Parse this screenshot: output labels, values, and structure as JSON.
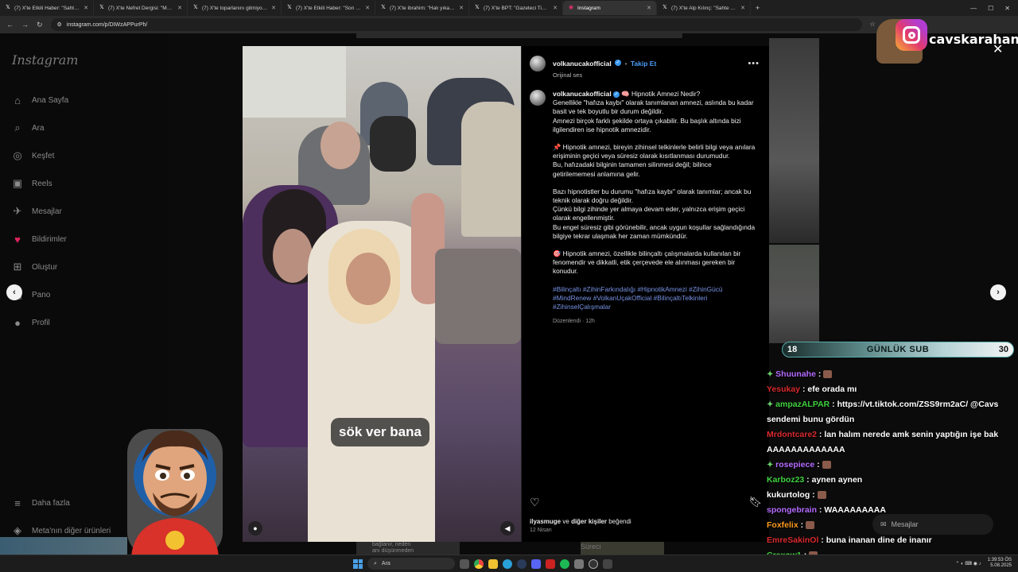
{
  "browser": {
    "tabs": [
      {
        "icon": "x-logo",
        "title": "(7) X'te Etkili Haber: \"Sahte diploma"
      },
      {
        "icon": "x-logo",
        "title": "(7) X'te Nefret Dergisi: \"Mersin'de"
      },
      {
        "icon": "x-logo",
        "title": "(7) X'te toparlanını gitmiyoruz"
      },
      {
        "icon": "x-logo",
        "title": "(7) X'te Etkili Haber: \"Son günlerde"
      },
      {
        "icon": "x-logo",
        "title": "(7) X'te ibrahim: \"Halı yıkamacı"
      },
      {
        "icon": "x-logo",
        "title": "(7) X'te BPT: \"Gazeteci Timur Soy"
      },
      {
        "icon": "instagram-logo",
        "title": "Instagram",
        "active": true
      },
      {
        "icon": "x-logo",
        "title": "(7) X'te Alp Kılınç: \"Sahte diploma"
      }
    ],
    "url": "instagram.com/p/DIWzAPPurPh/"
  },
  "sidebar": {
    "logo": "Instagram",
    "items": [
      {
        "icon": "home-icon",
        "glyph": "⌂",
        "label": "Ana Sayfa"
      },
      {
        "icon": "search-icon",
        "glyph": "⌕",
        "label": "Ara"
      },
      {
        "icon": "explore-icon",
        "glyph": "◎",
        "label": "Keşfet"
      },
      {
        "icon": "reels-icon",
        "glyph": "▣",
        "label": "Reels"
      },
      {
        "icon": "messages-icon",
        "glyph": "✈",
        "label": "Mesajlar"
      },
      {
        "icon": "heart-icon",
        "glyph": "♥",
        "label": "Bildirimler"
      },
      {
        "icon": "create-icon",
        "glyph": "⊞",
        "label": "Oluştur"
      },
      {
        "icon": "dashboard-icon",
        "glyph": "▤",
        "label": "Pano"
      },
      {
        "icon": "profile-icon",
        "glyph": "●",
        "label": "Profil"
      }
    ],
    "bottom": [
      {
        "icon": "menu-icon",
        "glyph": "≡",
        "label": "Daha fazla"
      },
      {
        "icon": "meta-icon",
        "glyph": "◈",
        "label": "Meta'nın diğer ürünleri"
      }
    ]
  },
  "post": {
    "username": "volkanucakofficial",
    "follow_label": "Takip Et",
    "audio": "Orijinal ses",
    "video_caption": "sök ver bana",
    "caption_title": "🧠 Hipnotik Amnezi Nedir?",
    "paragraphs": [
      "Genellikle \"hafıza kaybı\" olarak tanımlanan amnezi, aslında bu kadar basit ve tek boyutlu bir durum değildir.\nAmnezi birçok farklı şekilde ortaya çıkabilir. Bu başlık altında bizi ilgilendiren ise hipnotik amnezidir.",
      "📌 Hipnotik amnezi, bireyin zihinsel telkinlerle belirli bilgi veya anılara erişiminin geçici veya süresiz olarak kısıtlanması durumudur.\nBu, hafızadaki bilginin tamamen silinmesi değil; bilince getirilememesi anlamına gelir.",
      "Bazı hipnotistler bu durumu \"hafıza kaybı\" olarak tanımlar; ancak bu teknik olarak doğru değildir.\nÇünkü bilgi zihinde yer almaya devam eder, yalnızca erişim geçici olarak engellenmiştir.\nBu engel süresiz gibi görünebilir, ancak uygun koşullar sağlandığında bilgiye tekrar ulaşmak her zaman mümkündür.",
      "🎯 Hipnotik amnezi, özellikle bilinçaltı çalışmalarda kullanılan bir fenomendir ve dikkatli, etik çerçevede ele alınması gereken bir konudur."
    ],
    "hashtags": "#Bilinçaltı #ZihinFarkındalığı #HipnotikAmnezi #ZihinGücü #MindRenew #VolkanUçakOfficial #BilinçaltıTelkinleri #ZihinselÇalışmalar",
    "edited_meta": "Düzenlendi · 12h",
    "likes_user": "ilyasmuge",
    "likes_connector": "ve",
    "likes_others": "diğer kişiler",
    "likes_suffix": "beğendi",
    "date": "12 Nisan"
  },
  "stream": {
    "channel": "cavskarahanli",
    "sub_current": "18",
    "sub_label": "GÜNLÜK SUB",
    "sub_goal": "30",
    "chat": [
      {
        "user": "Shuunahe",
        "color": "#b46bff",
        "text": "",
        "badge": true,
        "emote": true
      },
      {
        "user": "Yesukay",
        "color": "#d9292d",
        "text": "efe orada mı",
        "badge": false
      },
      {
        "user": "ampazALPAR",
        "color": "#3fd13f",
        "text": "https://vt.tiktok.com/ZSS9rm2aC/ @Cavs sendemi bunu gördün",
        "badge": true
      },
      {
        "user": "Mrdontcare2",
        "color": "#d9292d",
        "text": "lan halım nerede amk senin yaptığın işe bak AAAAAAAAAAAAA",
        "badge": false
      },
      {
        "user": "rosepiece",
        "color": "#b46bff",
        "text": "",
        "badge": true,
        "emote": true
      },
      {
        "user": "Karboz23",
        "color": "#3fd13f",
        "text": "aynen aynen",
        "badge": false
      },
      {
        "user": "kukurtolog",
        "color": "#ffffff",
        "text": "",
        "badge": false,
        "emote": true
      },
      {
        "user": "spongebrain",
        "color": "#b46bff",
        "text": "WAAAAAAAAA",
        "badge": false
      },
      {
        "user": "Foxfelix",
        "color": "#ff9a1f",
        "text": "",
        "badge": false,
        "emote": true
      },
      {
        "user": "EmreSakinOl",
        "color": "#d9292d",
        "text": "buna inanan dine de inanır",
        "badge": false
      },
      {
        "user": "Crexow1",
        "color": "#3fd13f",
        "text": "",
        "badge": false,
        "emote": true
      }
    ],
    "msgbox_placeholder": "Mesajlar"
  },
  "taskbar": {
    "search_placeholder": "Ara",
    "time": "1:39:53 ÖS",
    "date": "5.08.2025"
  },
  "background_text": {
    "bottom_left": "bağlanır, neden\nanı düşünmeden",
    "bottom_mid": "Süreci"
  }
}
